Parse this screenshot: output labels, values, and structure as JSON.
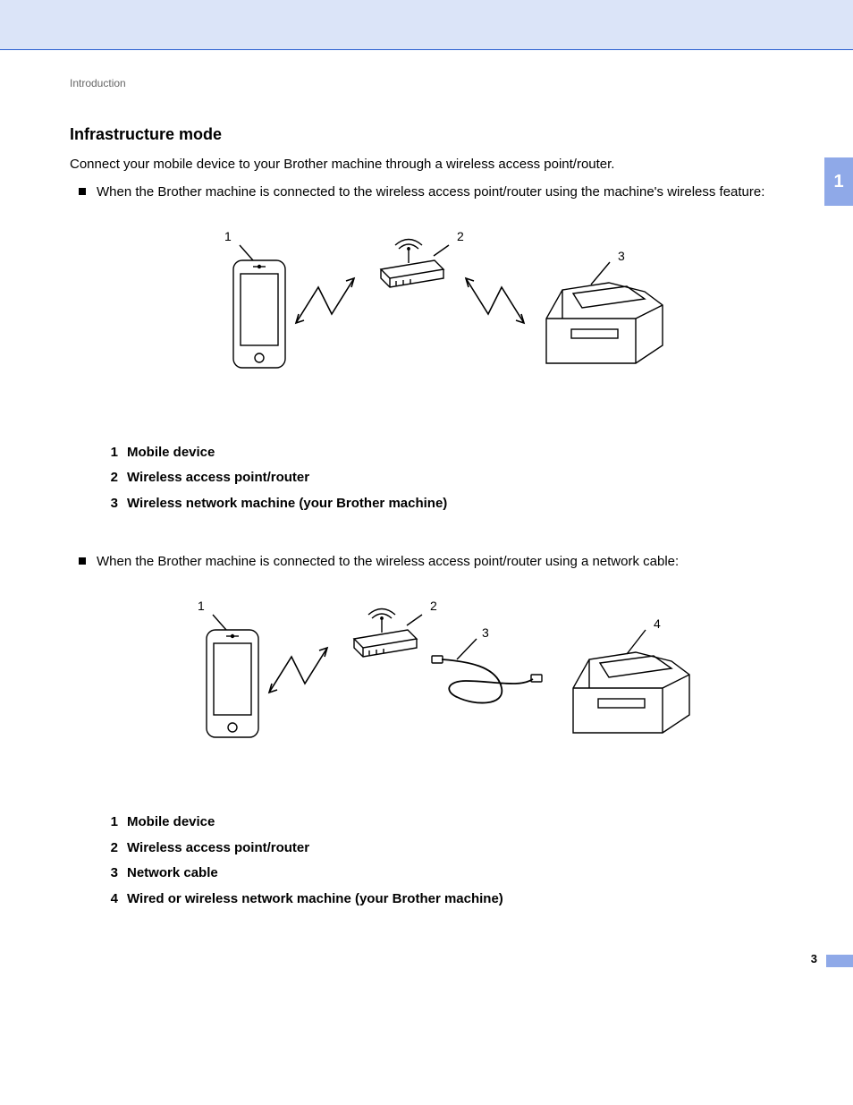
{
  "header": {
    "breadcrumb": "Introduction"
  },
  "chapter_tab": "1",
  "section": {
    "heading": "Infrastructure mode",
    "intro": "Connect your mobile device to your Brother machine through a wireless access point/router.",
    "bullet1": "When the Brother machine is connected to the wireless access point/router using the machine's wireless feature:",
    "bullet2": "When the Brother machine is connected to the wireless access point/router using a network cable:"
  },
  "diagram1": {
    "c1": "1",
    "c2": "2",
    "c3": "3",
    "legend": [
      {
        "n": "1",
        "t": "Mobile device"
      },
      {
        "n": "2",
        "t": "Wireless access point/router"
      },
      {
        "n": "3",
        "t": "Wireless network machine (your Brother machine)"
      }
    ]
  },
  "diagram2": {
    "c1": "1",
    "c2": "2",
    "c3": "3",
    "c4": "4",
    "legend": [
      {
        "n": "1",
        "t": "Mobile device"
      },
      {
        "n": "2",
        "t": "Wireless access point/router"
      },
      {
        "n": "3",
        "t": "Network cable"
      },
      {
        "n": "4",
        "t": "Wired or wireless network machine (your Brother machine)"
      }
    ]
  },
  "page_number": "3"
}
